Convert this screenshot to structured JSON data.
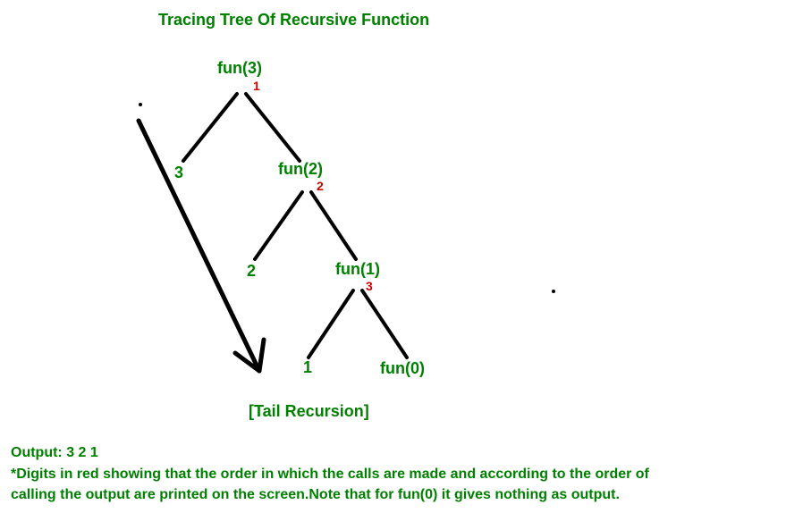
{
  "title": "Tracing Tree Of Recursive Function",
  "nodes": {
    "fun3": "fun(3)",
    "fun2": "fun(2)",
    "fun1": "fun(1)",
    "fun0": "fun(0)",
    "leaf3": "3",
    "leaf2": "2",
    "leaf1": "1"
  },
  "orders": {
    "o1": "1",
    "o2": "2",
    "o3": "3"
  },
  "subtitle": "[Tail Recursion]",
  "output": "Output: 3 2 1",
  "note_line1": "*Digits in red showing that the order in which the calls are made and according to the order of",
  "note_line2": "calling the output are printed on the screen.Note that for fun(0) it gives nothing as output.",
  "chart_data": {
    "type": "tree",
    "title": "Tracing Tree Of Recursive Function",
    "description": "Tail recursion tracing tree showing call order and printed values",
    "nodes": [
      {
        "id": "fun3",
        "label": "fun(3)",
        "call_order": 1,
        "children": [
          "leaf3",
          "fun2"
        ]
      },
      {
        "id": "leaf3",
        "label": "3",
        "printed": true
      },
      {
        "id": "fun2",
        "label": "fun(2)",
        "call_order": 2,
        "children": [
          "leaf2",
          "fun1"
        ]
      },
      {
        "id": "leaf2",
        "label": "2",
        "printed": true
      },
      {
        "id": "fun1",
        "label": "fun(1)",
        "call_order": 3,
        "children": [
          "leaf1",
          "fun0"
        ]
      },
      {
        "id": "leaf1",
        "label": "1",
        "printed": true
      },
      {
        "id": "fun0",
        "label": "fun(0)",
        "printed": false
      }
    ],
    "output_sequence": [
      3,
      2,
      1
    ],
    "recursion_type": "Tail Recursion"
  }
}
